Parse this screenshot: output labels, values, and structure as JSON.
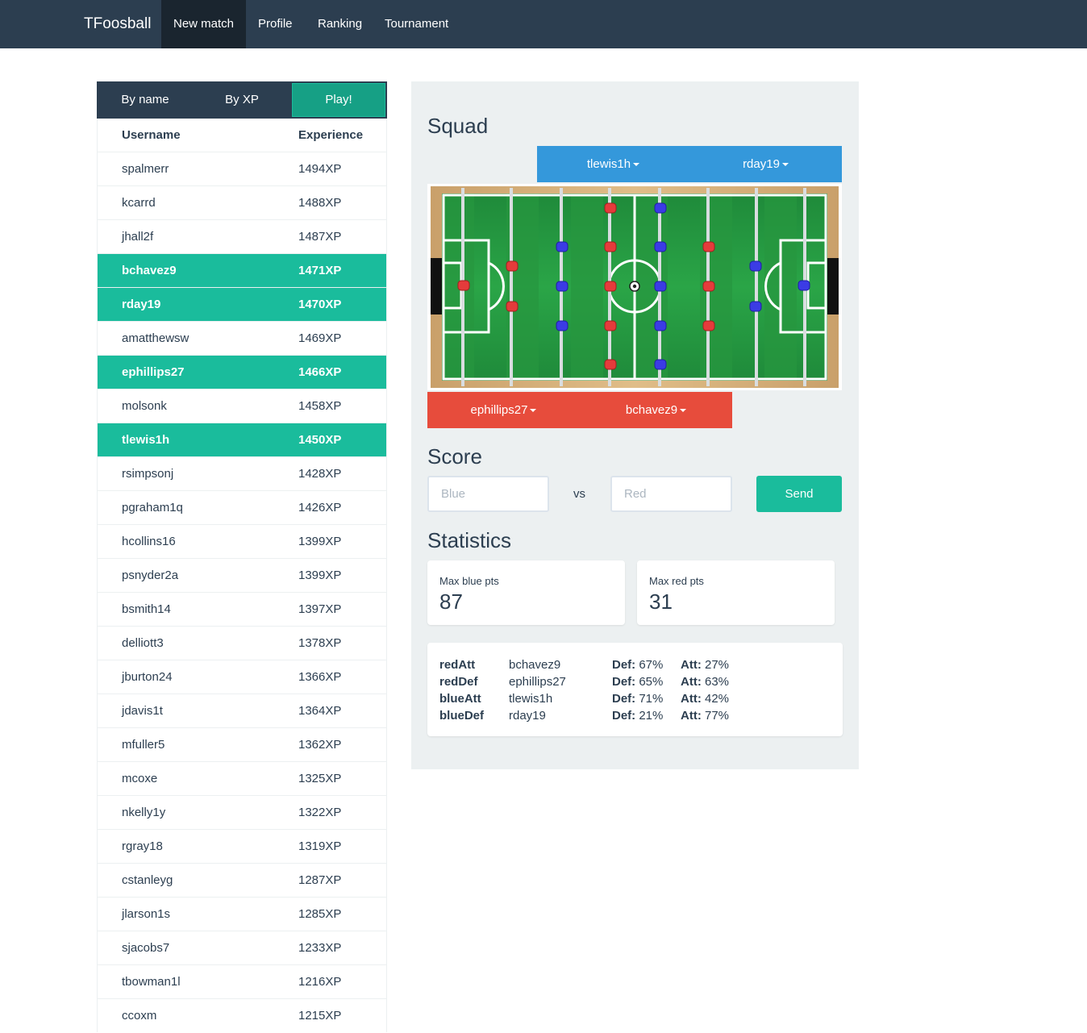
{
  "nav": {
    "brand": "TFoosball",
    "items": [
      {
        "label": "New match",
        "active": true
      },
      {
        "label": "Profile"
      },
      {
        "label": "Ranking"
      },
      {
        "label": "Tournament"
      }
    ]
  },
  "toolbar": {
    "by_name": "By name",
    "by_xp": "By XP",
    "play": "Play!"
  },
  "users_table": {
    "headers": {
      "username": "Username",
      "experience": "Experience"
    },
    "rows": [
      {
        "username": "spalmerr",
        "xp": "1494XP",
        "selected": false
      },
      {
        "username": "kcarrd",
        "xp": "1488XP",
        "selected": false
      },
      {
        "username": "jhall2f",
        "xp": "1487XP",
        "selected": false
      },
      {
        "username": "bchavez9",
        "xp": "1471XP",
        "selected": true
      },
      {
        "username": "rday19",
        "xp": "1470XP",
        "selected": true
      },
      {
        "username": "amatthewsw",
        "xp": "1469XP",
        "selected": false
      },
      {
        "username": "ephillips27",
        "xp": "1466XP",
        "selected": true
      },
      {
        "username": "molsonk",
        "xp": "1458XP",
        "selected": false
      },
      {
        "username": "tlewis1h",
        "xp": "1450XP",
        "selected": true
      },
      {
        "username": "rsimpsonj",
        "xp": "1428XP",
        "selected": false
      },
      {
        "username": "pgraham1q",
        "xp": "1426XP",
        "selected": false
      },
      {
        "username": "hcollins16",
        "xp": "1399XP",
        "selected": false
      },
      {
        "username": "psnyder2a",
        "xp": "1399XP",
        "selected": false
      },
      {
        "username": "bsmith14",
        "xp": "1397XP",
        "selected": false
      },
      {
        "username": "delliott3",
        "xp": "1378XP",
        "selected": false
      },
      {
        "username": "jburton24",
        "xp": "1366XP",
        "selected": false
      },
      {
        "username": "jdavis1t",
        "xp": "1364XP",
        "selected": false
      },
      {
        "username": "mfuller5",
        "xp": "1362XP",
        "selected": false
      },
      {
        "username": "mcoxe",
        "xp": "1325XP",
        "selected": false
      },
      {
        "username": "nkelly1y",
        "xp": "1322XP",
        "selected": false
      },
      {
        "username": "rgray18",
        "xp": "1319XP",
        "selected": false
      },
      {
        "username": "cstanleyg",
        "xp": "1287XP",
        "selected": false
      },
      {
        "username": "jlarson1s",
        "xp": "1285XP",
        "selected": false
      },
      {
        "username": "sjacobs7",
        "xp": "1233XP",
        "selected": false
      },
      {
        "username": "tbowman1l",
        "xp": "1216XP",
        "selected": false
      },
      {
        "username": "ccoxm",
        "xp": "1215XP",
        "selected": false
      }
    ]
  },
  "squad": {
    "title": "Squad",
    "blue": {
      "attacker": "tlewis1h",
      "defender": "rday19"
    },
    "red": {
      "defender": "ephillips27",
      "attacker": "bchavez9"
    }
  },
  "score": {
    "title": "Score",
    "blue_placeholder": "Blue",
    "red_placeholder": "Red",
    "vs": "vs",
    "send": "Send"
  },
  "statistics": {
    "title": "Statistics",
    "max_blue_label": "Max blue pts",
    "max_blue_value": "87",
    "max_red_label": "Max red pts",
    "max_red_value": "31",
    "def_label": "Def:",
    "att_label": "Att:",
    "rows": [
      {
        "role": "redAtt",
        "player": "bchavez9",
        "def": "67%",
        "att": "27%"
      },
      {
        "role": "redDef",
        "player": "ephillips27",
        "def": "65%",
        "att": "63%"
      },
      {
        "role": "blueAtt",
        "player": "tlewis1h",
        "def": "71%",
        "att": "42%"
      },
      {
        "role": "blueDef",
        "player": "rday19",
        "def": "21%",
        "att": "77%"
      }
    ]
  },
  "colors": {
    "navbar": "#2c3e50",
    "teal": "#1abc9c",
    "blue_team": "#3498db",
    "red_team": "#e74c3c",
    "panel": "#ecf0f1"
  }
}
